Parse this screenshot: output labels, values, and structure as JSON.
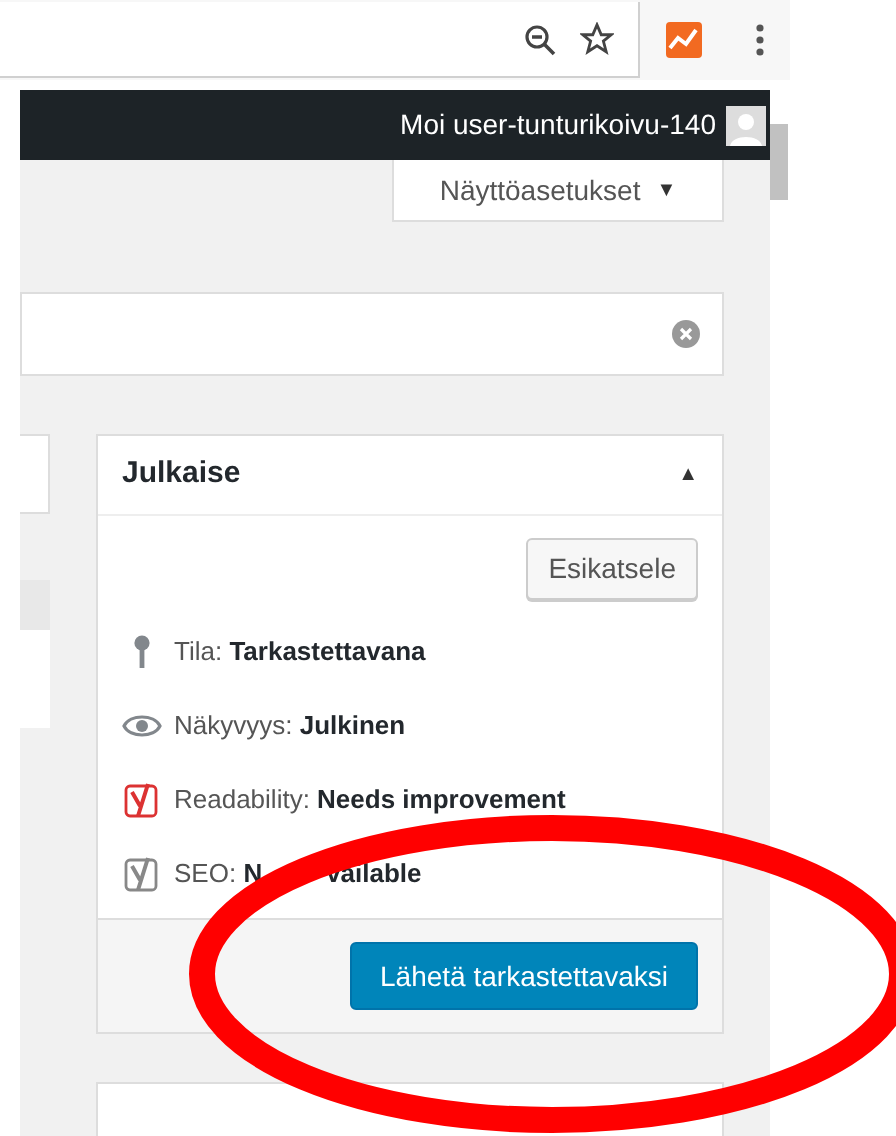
{
  "admin_bar": {
    "greeting": "Moi user-tunturikoivu-140"
  },
  "screen_options": {
    "label": "Näyttöasetukset",
    "caret": "▼"
  },
  "publish_box": {
    "title": "Julkaise",
    "toggle": "▲",
    "preview_button": "Esikatsele",
    "rows": [
      {
        "kind": "pin",
        "label": "Tila:",
        "value": "Tarkastettavana"
      },
      {
        "kind": "eye",
        "label": "Näkyvyys:",
        "value": "Julkinen"
      },
      {
        "kind": "yoast",
        "color": "#dc3232",
        "label": "Readability:",
        "value": "Needs improvement"
      },
      {
        "kind": "yoast",
        "color": "#888888",
        "label": "SEO:",
        "value_parts": [
          "N",
          "vailable"
        ]
      }
    ],
    "submit_button": "Lähetä tarkastettavaksi"
  }
}
